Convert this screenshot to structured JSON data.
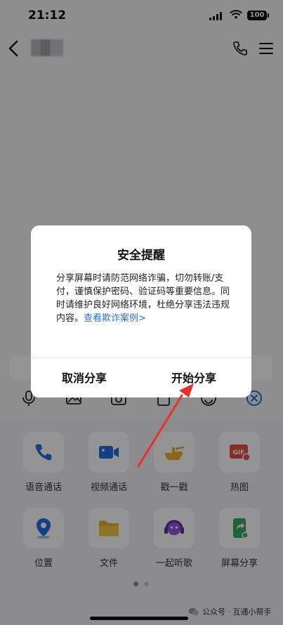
{
  "status": {
    "time": "21:12",
    "battery": "100"
  },
  "nav": {
    "contact_name": ""
  },
  "functions": [
    {
      "label": "语音通话",
      "icon": "phone-icon"
    },
    {
      "label": "视频通话",
      "icon": "video-camera-icon"
    },
    {
      "label": "戳一戳",
      "icon": "poke-hand-icon"
    },
    {
      "label": "热图",
      "icon": "gif-icon"
    },
    {
      "label": "位置",
      "icon": "location-pin-icon"
    },
    {
      "label": "文件",
      "icon": "folder-icon"
    },
    {
      "label": "一起听歌",
      "icon": "listen-together-icon"
    },
    {
      "label": "屏幕分享",
      "icon": "screen-share-icon"
    }
  ],
  "dialog": {
    "title": "安全提醒",
    "message": "分享屏幕时请防范网络诈骗，切勿转账/支付，谨慎保护密码、验证码等重要信息。同时请维护良好网络环境，杜绝分享违法违规内容。",
    "link": "查看欺诈案例>",
    "cancel_label": "取消分享",
    "confirm_label": "开始分享"
  },
  "watermark": {
    "text": "公众号 · 互通小帮手"
  },
  "colors": {
    "link": "#2d6fd6",
    "arrow": "#e5322d",
    "accent_blue": "#1f6fe0"
  }
}
